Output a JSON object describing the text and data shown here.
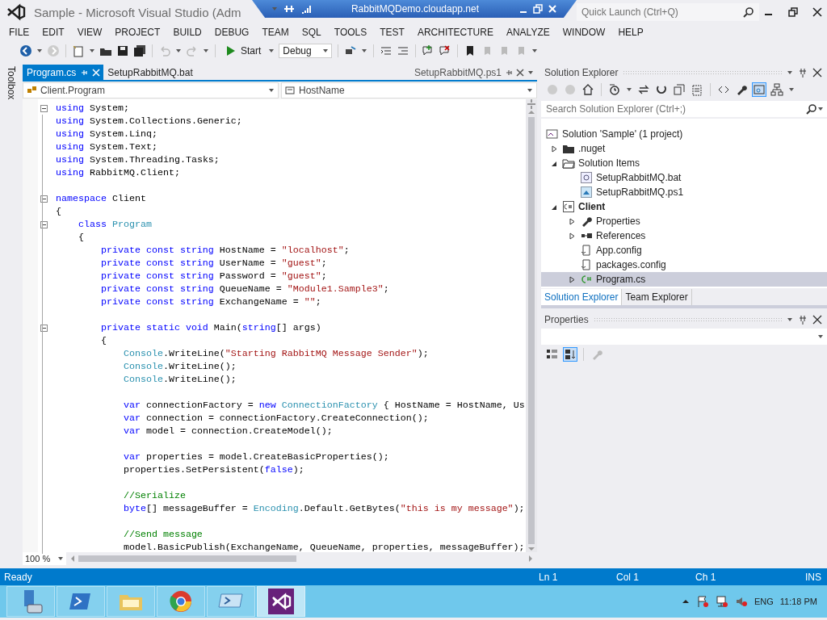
{
  "title_bar": {
    "title": "Sample - Microsoft Visual Studio (Adm",
    "remote_host": "RabbitMQDemo.cloudapp.net",
    "quick_launch": {
      "placeholder": "Quick Launch (Ctrl+Q)"
    }
  },
  "menu": [
    "FILE",
    "EDIT",
    "VIEW",
    "PROJECT",
    "BUILD",
    "DEBUG",
    "TEAM",
    "SQL",
    "TOOLS",
    "TEST",
    "ARCHITECTURE",
    "ANALYZE",
    "WINDOW",
    "HELP"
  ],
  "toolbar": {
    "start": "Start",
    "configuration": "Debug"
  },
  "toolbox": "Toolbox",
  "editor": {
    "tabs": [
      {
        "label": "Program.cs",
        "selected": true,
        "kind": "open"
      },
      {
        "label": "SetupRabbitMQ.bat",
        "selected": false,
        "kind": "open"
      },
      {
        "label": "SetupRabbitMQ.ps1",
        "selected": false,
        "kind": "preview"
      }
    ],
    "type_dropdown": "Client.Program",
    "member_dropdown": "HostName",
    "zoom": "100 %",
    "lines": [
      {
        "kind": "code",
        "fold": true,
        "segs": [
          {
            "keyword": "using"
          },
          {
            "plain": " System;"
          }
        ]
      },
      {
        "kind": "code",
        "fold": false,
        "segs": [
          {
            "keyword": "using"
          },
          {
            "plain": " System.Collections.Generic;"
          }
        ]
      },
      {
        "kind": "code",
        "fold": false,
        "segs": [
          {
            "keyword": "using"
          },
          {
            "plain": " System.Linq;"
          }
        ]
      },
      {
        "kind": "code",
        "fold": false,
        "segs": [
          {
            "keyword": "using"
          },
          {
            "plain": " System.Text;"
          }
        ]
      },
      {
        "kind": "code",
        "fold": false,
        "segs": [
          {
            "keyword": "using"
          },
          {
            "plain": " System.Threading.Tasks;"
          }
        ]
      },
      {
        "kind": "code",
        "fold": false,
        "segs": [
          {
            "keyword": "using"
          },
          {
            "plain": " RabbitMQ.Client;"
          }
        ]
      },
      {
        "kind": "blank"
      },
      {
        "kind": "code",
        "fold": true,
        "segs": [
          {
            "keyword": "namespace"
          },
          {
            "plain": " Client"
          }
        ]
      },
      {
        "kind": "code",
        "fold": false,
        "segs": [
          {
            "plain": "{"
          }
        ]
      },
      {
        "kind": "code",
        "fold": true,
        "segs": [
          {
            "keyword": "    class"
          },
          {
            "type": " Program"
          }
        ]
      },
      {
        "kind": "code",
        "fold": false,
        "segs": [
          {
            "plain": "    {"
          }
        ]
      },
      {
        "kind": "code",
        "fold": false,
        "segs": [
          {
            "keyword": "        private const string"
          },
          {
            "plain": " HostName = "
          },
          {
            "string": "\"localhost\""
          },
          {
            "plain": ";"
          }
        ]
      },
      {
        "kind": "code",
        "fold": false,
        "segs": [
          {
            "keyword": "        private const string"
          },
          {
            "plain": " UserName = "
          },
          {
            "string": "\"guest\""
          },
          {
            "plain": ";"
          }
        ]
      },
      {
        "kind": "code",
        "fold": false,
        "segs": [
          {
            "keyword": "        private const string"
          },
          {
            "plain": " Password = "
          },
          {
            "string": "\"guest\""
          },
          {
            "plain": ";"
          }
        ]
      },
      {
        "kind": "code",
        "fold": false,
        "segs": [
          {
            "keyword": "        private const string"
          },
          {
            "plain": " QueueName = "
          },
          {
            "string": "\"Module1.Sample3\""
          },
          {
            "plain": ";"
          }
        ]
      },
      {
        "kind": "code",
        "fold": false,
        "segs": [
          {
            "keyword": "        private const string"
          },
          {
            "plain": " ExchangeName = "
          },
          {
            "string": "\"\""
          },
          {
            "plain": ";"
          }
        ]
      },
      {
        "kind": "blank"
      },
      {
        "kind": "code",
        "fold": true,
        "segs": [
          {
            "keyword": "        private static void"
          },
          {
            "plain": " Main("
          },
          {
            "keyword": "string"
          },
          {
            "plain": "[] args)"
          }
        ]
      },
      {
        "kind": "code",
        "fold": false,
        "segs": [
          {
            "plain": "        {"
          }
        ]
      },
      {
        "kind": "code",
        "fold": false,
        "segs": [
          {
            "type": "            Console"
          },
          {
            "plain": ".WriteLine("
          },
          {
            "string": "\"Starting RabbitMQ Message Sender\""
          },
          {
            "plain": ");"
          }
        ]
      },
      {
        "kind": "code",
        "fold": false,
        "segs": [
          {
            "type": "            Console"
          },
          {
            "plain": ".WriteLine();"
          }
        ]
      },
      {
        "kind": "code",
        "fold": false,
        "segs": [
          {
            "type": "            Console"
          },
          {
            "plain": ".WriteLine();"
          }
        ]
      },
      {
        "kind": "blank"
      },
      {
        "kind": "code",
        "fold": false,
        "segs": [
          {
            "keyword": "            var"
          },
          {
            "plain": " connectionFactory = "
          },
          {
            "keyword": "new"
          },
          {
            "type": " ConnectionFactory"
          },
          {
            "plain": " { HostName = HostName, Us"
          }
        ]
      },
      {
        "kind": "code",
        "fold": false,
        "segs": [
          {
            "keyword": "            var"
          },
          {
            "plain": " connection = connectionFactory.CreateConnection();"
          }
        ]
      },
      {
        "kind": "code",
        "fold": false,
        "segs": [
          {
            "keyword": "            var"
          },
          {
            "plain": " model = connection.CreateModel();"
          }
        ]
      },
      {
        "kind": "blank"
      },
      {
        "kind": "code",
        "fold": false,
        "segs": [
          {
            "keyword": "            var"
          },
          {
            "plain": " properties = model.CreateBasicProperties();"
          }
        ]
      },
      {
        "kind": "code",
        "fold": false,
        "segs": [
          {
            "plain": "            properties.SetPersistent("
          },
          {
            "keyword": "false"
          },
          {
            "plain": ");"
          }
        ]
      },
      {
        "kind": "blank"
      },
      {
        "kind": "code",
        "fold": false,
        "segs": [
          {
            "comment": "            //Serialize"
          }
        ]
      },
      {
        "kind": "code",
        "fold": false,
        "segs": [
          {
            "keyword": "            byte"
          },
          {
            "plain": "[] messageBuffer = "
          },
          {
            "type": "Encoding"
          },
          {
            "plain": ".Default.GetBytes("
          },
          {
            "string": "\"this is my message\""
          },
          {
            "plain": ");"
          }
        ]
      },
      {
        "kind": "blank"
      },
      {
        "kind": "code",
        "fold": false,
        "segs": [
          {
            "comment": "            //Send message"
          }
        ]
      },
      {
        "kind": "code",
        "fold": false,
        "segs": [
          {
            "plain": "            model.BasicPublish(ExchangeName, QueueName, properties, messageBuffer);"
          }
        ]
      }
    ]
  },
  "solution_explorer": {
    "title": "Solution Explorer",
    "search": {
      "placeholder": "Search Solution Explorer (Ctrl+;)"
    },
    "tree": [
      {
        "label": "Solution 'Sample' (1 project)",
        "kind": "solution",
        "selected": false,
        "children": [
          {
            "label": ".nuget",
            "kind": "folder",
            "expanded": false,
            "selected": false
          },
          {
            "label": "Solution Items",
            "kind": "folder-open",
            "expanded": true,
            "selected": false,
            "children": [
              {
                "label": "SetupRabbitMQ.bat",
                "kind": "bat",
                "selected": false
              },
              {
                "label": "SetupRabbitMQ.ps1",
                "kind": "ps1",
                "selected": false
              }
            ]
          },
          {
            "label": "Client",
            "kind": "project",
            "expanded": true,
            "selected": false,
            "children": [
              {
                "label": "Properties",
                "kind": "properties",
                "expanded": false,
                "selected": false
              },
              {
                "label": "References",
                "kind": "references",
                "expanded": false,
                "selected": false
              },
              {
                "label": "App.config",
                "kind": "config",
                "selected": false
              },
              {
                "label": "packages.config",
                "kind": "config",
                "selected": false
              },
              {
                "label": "Program.cs",
                "kind": "cs",
                "expanded": false,
                "selected": true
              }
            ]
          }
        ]
      }
    ],
    "tabs": [
      {
        "label": "Solution Explorer",
        "selected": true
      },
      {
        "label": "Team Explorer",
        "selected": false
      }
    ]
  },
  "properties": {
    "title": "Properties"
  },
  "status_bar": {
    "message": "Ready",
    "line": "Ln 1",
    "column": "Col 1",
    "char": "Ch 1",
    "mode": "INS"
  },
  "taskbar": {
    "apps": [
      {
        "kind": "server",
        "selected": false
      },
      {
        "kind": "powershell",
        "selected": false
      },
      {
        "kind": "explorer",
        "selected": false
      },
      {
        "kind": "browser",
        "selected": false
      },
      {
        "kind": "terminal",
        "selected": false
      },
      {
        "kind": "studio",
        "selected": true
      }
    ],
    "language": "ENG",
    "time": "11:18 PM"
  }
}
